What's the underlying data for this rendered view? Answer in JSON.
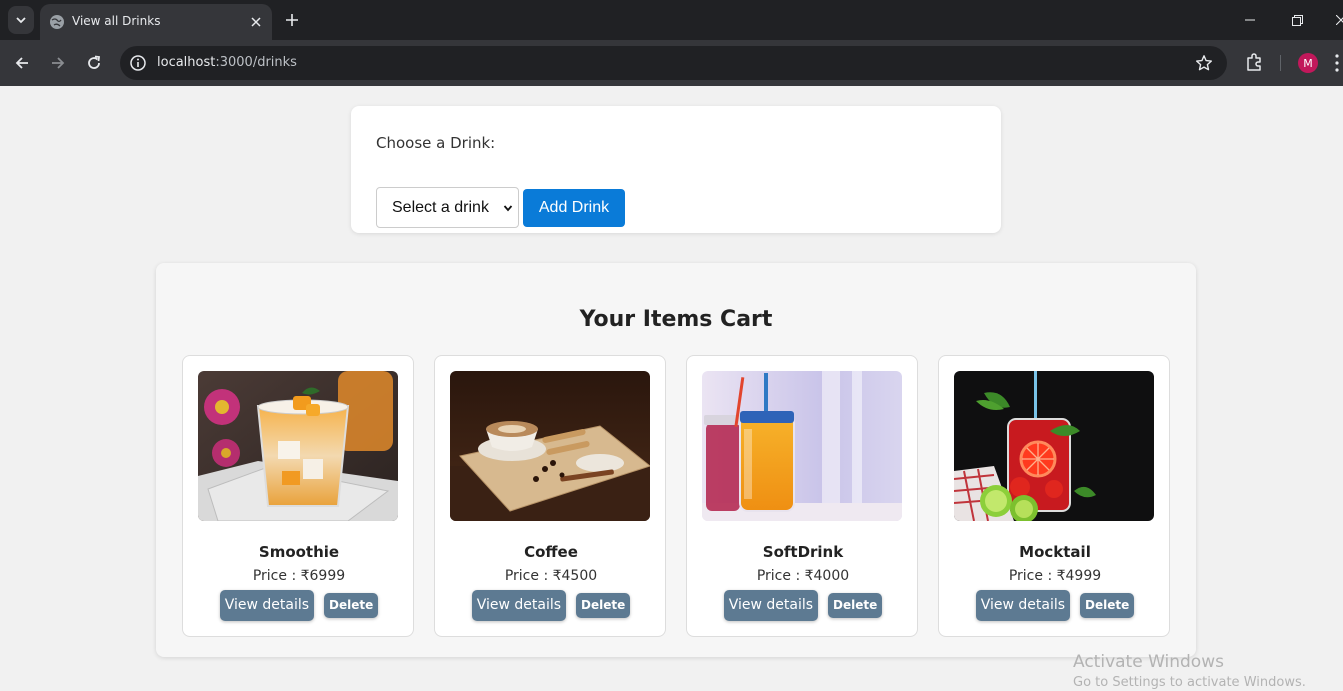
{
  "browser": {
    "tab_title": "View all Drinks",
    "url_host": "localhost",
    "url_path": ":3000/drinks",
    "profile_initial": "M"
  },
  "chooser": {
    "label": "Choose a Drink:",
    "select_value": "Select a drink",
    "add_button": "Add Drink"
  },
  "cart": {
    "title": "Your Items Cart",
    "items": [
      {
        "name": "Smoothie",
        "price": "Price : ₹6999",
        "view_label": "View details",
        "delete_label": "Delete",
        "image": "smoothie-photo"
      },
      {
        "name": "Coffee",
        "price": "Price : ₹4500",
        "view_label": "View details",
        "delete_label": "Delete",
        "image": "coffee-photo"
      },
      {
        "name": "SoftDrink",
        "price": "Price : ₹4000",
        "view_label": "View details",
        "delete_label": "Delete",
        "image": "softdrink-photo"
      },
      {
        "name": "Mocktail",
        "price": "Price : ₹4999",
        "view_label": "View details",
        "delete_label": "Delete",
        "image": "mocktail-photo"
      }
    ]
  },
  "watermark": {
    "title": "Activate Windows",
    "subtitle": "Go to Settings to activate Windows."
  },
  "colors": {
    "accent": "#0a7bd8",
    "card_button": "#5d7a92",
    "page_bg": "#f1f1f1"
  }
}
